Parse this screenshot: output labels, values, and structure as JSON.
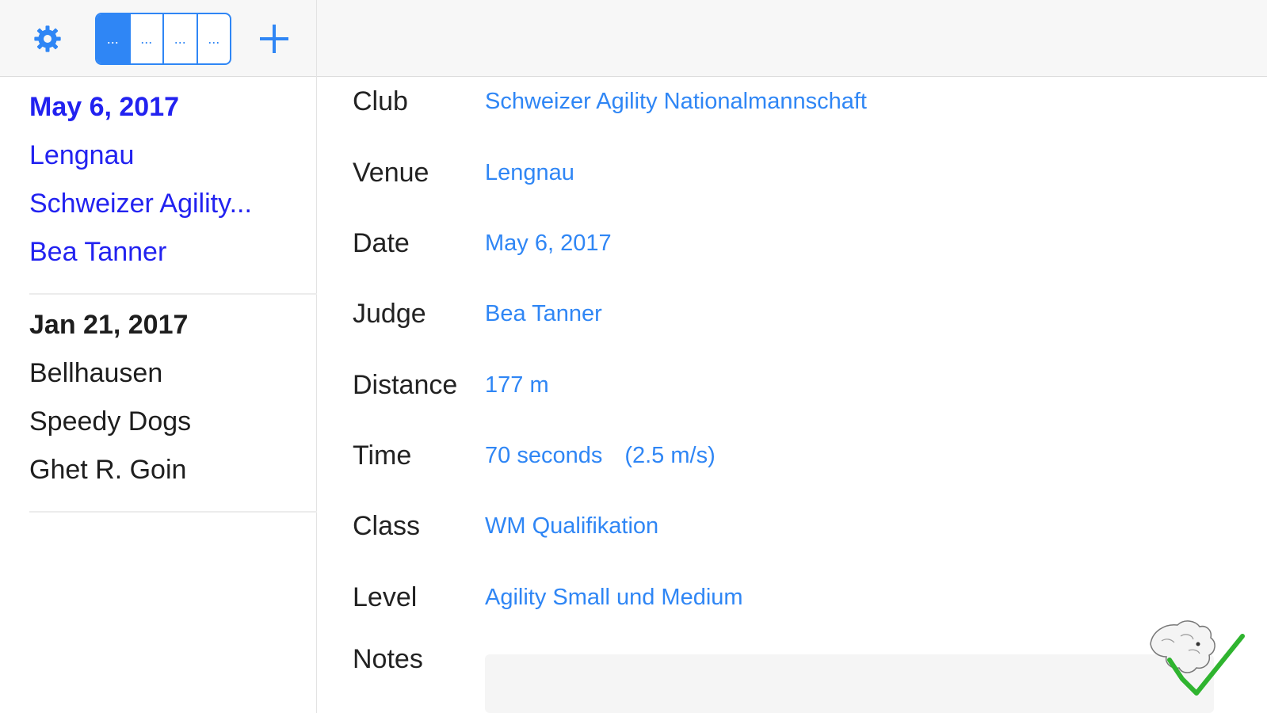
{
  "toolbar": {
    "segments": [
      "...",
      "...",
      "...",
      "..."
    ],
    "icons": {
      "settings": "gear-icon",
      "add": "plus-icon"
    },
    "accent": "#2f86f5"
  },
  "sidebar": {
    "entries": [
      {
        "date": "May 6, 2017",
        "venue": "Lengnau",
        "club": "Schweizer Agility...",
        "judge": "Bea Tanner",
        "selected": true
      },
      {
        "date": "Jan 21, 2017",
        "venue": "Bellhausen",
        "club": "Speedy Dogs",
        "judge": "Ghet R. Goin",
        "selected": false
      }
    ],
    "selected_color": "#2222f0"
  },
  "detail": {
    "rows": [
      {
        "label": "Club",
        "value": "Schweizer Agility Nationalmannschaft"
      },
      {
        "label": "Venue",
        "value": "Lengnau"
      },
      {
        "label": "Date",
        "value": "May 6, 2017"
      },
      {
        "label": "Judge",
        "value": "Bea Tanner"
      },
      {
        "label": "Distance",
        "value": "177 m"
      },
      {
        "label": "Time",
        "value": "70 seconds",
        "extra": "(2.5 m/s)"
      },
      {
        "label": "Class",
        "value": "WM Qualifikation"
      },
      {
        "label": "Level",
        "value": "Agility Small und Medium"
      }
    ],
    "notes_label": "Notes",
    "notes_value": ""
  }
}
